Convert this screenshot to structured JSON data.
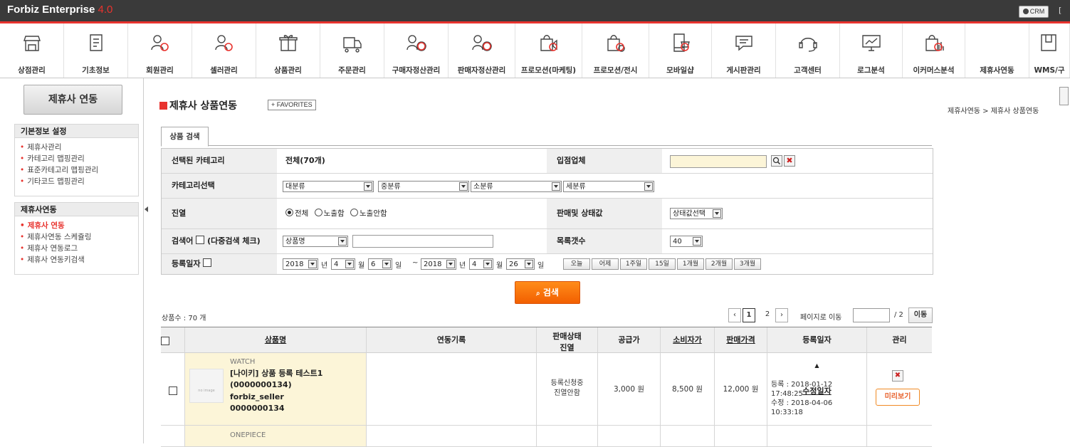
{
  "app": {
    "brand": "Forbiz Enterprise",
    "version": "4.0",
    "crm_label": "CRM",
    "top_right": "["
  },
  "menu": [
    {
      "label": "상점관리",
      "icon": "store-icon"
    },
    {
      "label": "기초정보",
      "icon": "document-icon"
    },
    {
      "label": "회원관리",
      "icon": "member-settings-icon"
    },
    {
      "label": "셀러관리",
      "icon": "seller-settings-icon"
    },
    {
      "label": "상품관리",
      "icon": "gift-box-icon"
    },
    {
      "label": "주문관리",
      "icon": "delivery-truck-icon"
    },
    {
      "label": "구매자정산관리",
      "icon": "buyer-won-icon"
    },
    {
      "label": "판매자정산관리",
      "icon": "seller-won-icon"
    },
    {
      "label": "프로모션(마케팅)",
      "icon": "megaphone-bag-icon"
    },
    {
      "label": "프로모션/전시",
      "icon": "bag-settings-icon"
    },
    {
      "label": "모바일샵",
      "icon": "mobile-cart-icon"
    },
    {
      "label": "게시판관리",
      "icon": "message-board-icon"
    },
    {
      "label": "고객센터",
      "icon": "headset-icon"
    },
    {
      "label": "로그분석",
      "icon": "chart-monitor-icon"
    },
    {
      "label": "이커머스분석",
      "icon": "bag-chart-icon"
    },
    {
      "label": "제휴사연동",
      "icon": ""
    },
    {
      "label": "WMS/구",
      "icon": "wms-icon"
    }
  ],
  "sidebar": {
    "title": "제휴사 연동",
    "section1": {
      "title": "기본정보 설정",
      "items": [
        "제휴사관리",
        "카테고리 맵핑관리",
        "표준카테고리 맵핑관리",
        "기타코드 맵핑관리"
      ]
    },
    "section2": {
      "title": "제휴사연동",
      "items": [
        "제휴사 연동",
        "제휴사연동 스케쥴링",
        "제휴사 연동로그",
        "제휴사 연동키검색"
      ]
    }
  },
  "page": {
    "title": "제휴사 상품연동",
    "favorites": "+ FAVORITES",
    "breadcrumb": "제휴사연동 > 제휴사 상품연동"
  },
  "tab": "상품 검색",
  "form": {
    "category_label": "선택된 카테고리",
    "category_value": "전체(70개)",
    "vendor_label": "입점업체",
    "catsel_label": "카테고리선택",
    "cat_selects": [
      "대분류",
      "중분류",
      "소분류",
      "세분류"
    ],
    "display_label": "진열",
    "display_options": [
      "전체",
      "노출함",
      "노출안함"
    ],
    "status_label": "판매및 상태값",
    "status_select": "상태값선택",
    "keyword_label_a": "검색어",
    "keyword_label_b": "(다중검색 체크)",
    "keyword_select": "상품명",
    "rows_label": "목록갯수",
    "rows_select": "40",
    "date_label": "등록일자",
    "date_from": {
      "year": "2018",
      "month": "4",
      "day": "6"
    },
    "date_to": {
      "year": "2018",
      "month": "4",
      "day": "26"
    },
    "unit_year": "년",
    "unit_month": "월",
    "unit_day": "일",
    "tilde": "~",
    "quick_dates": [
      "오늘",
      "어제",
      "1주일",
      "15일",
      "1개월",
      "2개월",
      "3개월"
    ],
    "search_button": "검색"
  },
  "list": {
    "count": "상품수 : 70 개",
    "pages": [
      "‹",
      "1",
      "2",
      "›"
    ],
    "goto_label": "페이지로 이동",
    "total_pages": "/ 2",
    "go_button": "이동",
    "headers": {
      "name": "상품명",
      "log": "연동기록",
      "status_a": "판매상태",
      "status_b": "진열",
      "supply": "공급가",
      "consumer": "소비자가",
      "sale": "판매가격",
      "date_a": "등록일자",
      "date_sort": "▲",
      "date_b": "수정일자",
      "manage": "관리"
    },
    "rows": [
      {
        "category": "WATCH",
        "name": "[나이키] 상품 등록 테스트1 (0000000134)",
        "seller": "forbiz_seller",
        "code": "0000000134",
        "thumb": "no image",
        "status": "등록신청중",
        "display": "진열안함",
        "supply": "3,000 원",
        "consumer": "8,500 원",
        "sale": "12,000 원",
        "registered": "등록 : 2018-01-12 17:48:25",
        "modified": "수정 : 2018-04-06 10:33:18",
        "preview": "미리보기"
      },
      {
        "category": "ONEPIECE"
      }
    ]
  }
}
